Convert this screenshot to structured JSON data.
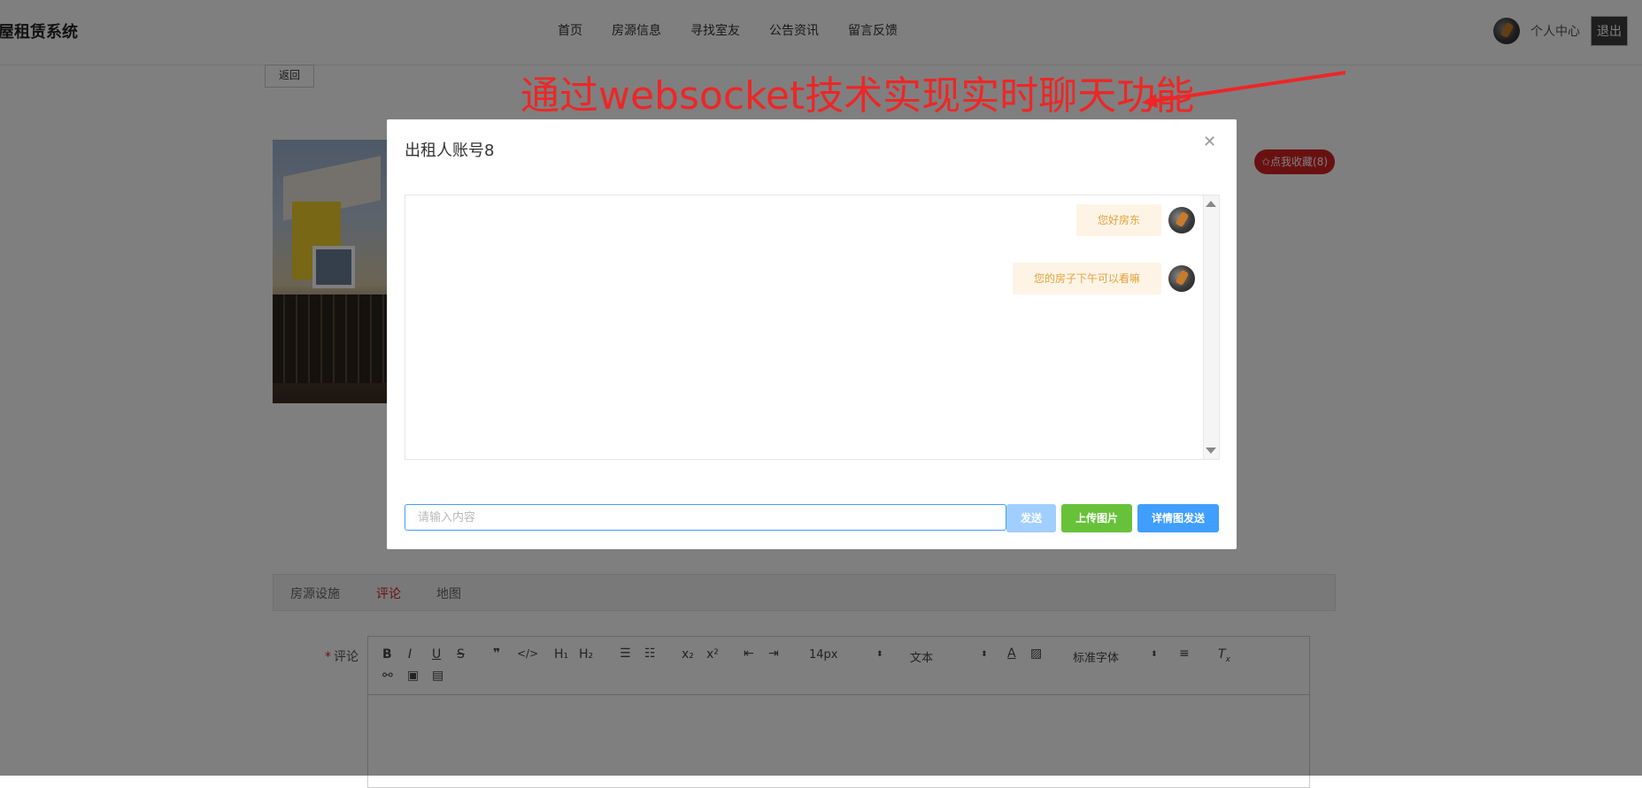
{
  "header": {
    "site_title": "屋租赁系统",
    "nav": [
      "首页",
      "房源信息",
      "寻找室友",
      "公告资讯",
      "留言反馈"
    ],
    "user_center": "个人中心",
    "logout": "退出"
  },
  "page": {
    "back": "返回",
    "favorite": "✩点我收藏(8)",
    "tabs": [
      "房源设施",
      "评论",
      "地图"
    ],
    "active_tab": "评论",
    "comment_label": "评论",
    "required_mark": "*",
    "editor": {
      "font_size": "14px",
      "text_type": "文本",
      "font_family": "标准字体"
    }
  },
  "annotation": {
    "text": "通过websocket技术实现实时聊天功能",
    "color": "#ee2626"
  },
  "dialog": {
    "title": "出租人账号8",
    "messages": [
      "您好房东",
      "您的房子下午可以看嘛"
    ],
    "input_placeholder": "请输入内容",
    "send": "发送",
    "upload_image": "上传图片",
    "detail_send": "详情图发送"
  },
  "colors": {
    "primary": "#409eff",
    "success": "#67c23a",
    "danger": "#d32222",
    "bubble_text": "#e6a23c"
  }
}
